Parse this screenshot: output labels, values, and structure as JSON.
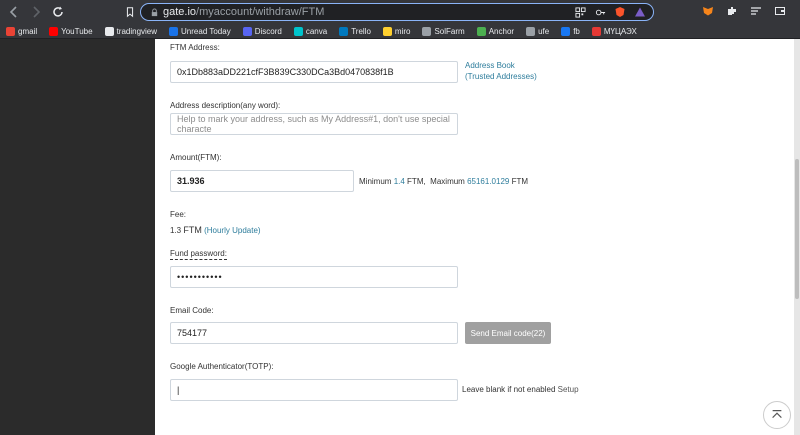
{
  "browser": {
    "url_host": "gate.io",
    "url_path": "/myaccount/withdraw/FTM"
  },
  "bookmarks": [
    {
      "label": "gmail",
      "color": "#ea4335"
    },
    {
      "label": "YouTube",
      "color": "#ff0000"
    },
    {
      "label": "tradingview",
      "color": "#e8eaed"
    },
    {
      "label": "Unread Today",
      "color": "#1a73e8"
    },
    {
      "label": "Discord",
      "color": "#5865f2"
    },
    {
      "label": "canva",
      "color": "#00c4cc"
    },
    {
      "label": "Trello",
      "color": "#0079bf"
    },
    {
      "label": "miro",
      "color": "#ffd02f"
    },
    {
      "label": "SolFarm",
      "color": "#9aa0a6"
    },
    {
      "label": "Anchor",
      "color": "#4caf50"
    },
    {
      "label": "ufe",
      "color": "#9aa0a6"
    },
    {
      "label": "fb",
      "color": "#1877f2"
    },
    {
      "label": "МҮЦАЭХ",
      "color": "#e53935"
    }
  ],
  "form": {
    "ftm_address_label": "FTM Address:",
    "ftm_address_value": "0x1Db883aDD221cfF3B839C330DCa3Bd0470838f1B",
    "address_book": "Address Book",
    "trusted_addresses": "(Trusted Addresses)",
    "description_label": "Address description(any word):",
    "description_placeholder": "Help to mark your address, such as My Address#1, don't use special characte",
    "amount_label": "Amount(FTM):",
    "amount_value": "31.936",
    "minimum_label": "Minimum",
    "minimum_value": "1.4",
    "minimum_unit": "FTM,",
    "maximum_label": "Maximum",
    "maximum_value": "65161.0129",
    "maximum_unit": "FTM",
    "fee_label": "Fee:",
    "fee_value": "1.3",
    "fee_unit": "FTM",
    "hourly_update": "(Hourly Update)",
    "fund_password_label": "Fund password:",
    "fund_password_value": "•••••••••••",
    "email_code_label": "Email Code:",
    "email_code_value": "754177",
    "send_email_button": "Send Email code(22)",
    "ga_label": "Google Authenticator(TOTP):",
    "ga_value": "|",
    "leave_blank": "Leave blank if not enabled",
    "setup": "Setup"
  }
}
